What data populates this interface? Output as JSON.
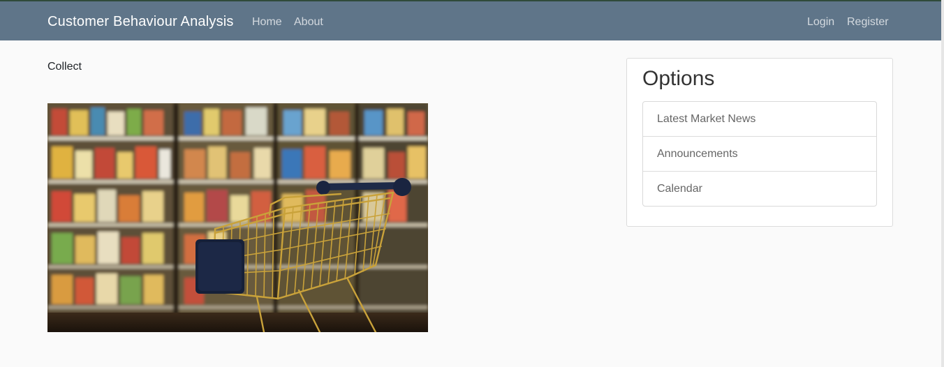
{
  "navbar": {
    "brand": "Customer Behaviour Analysis",
    "left_links": [
      "Home",
      "About"
    ],
    "right_links": [
      "Login",
      "Register"
    ]
  },
  "main": {
    "intro_text": "Collect",
    "hero_image_icon": "shopping-cart-image"
  },
  "sidebar": {
    "title": "Options",
    "items": [
      "Latest Market News",
      "Announcements",
      "Calendar"
    ]
  },
  "colors": {
    "navbar": "#5f7589",
    "page_background": "#fafafa"
  }
}
